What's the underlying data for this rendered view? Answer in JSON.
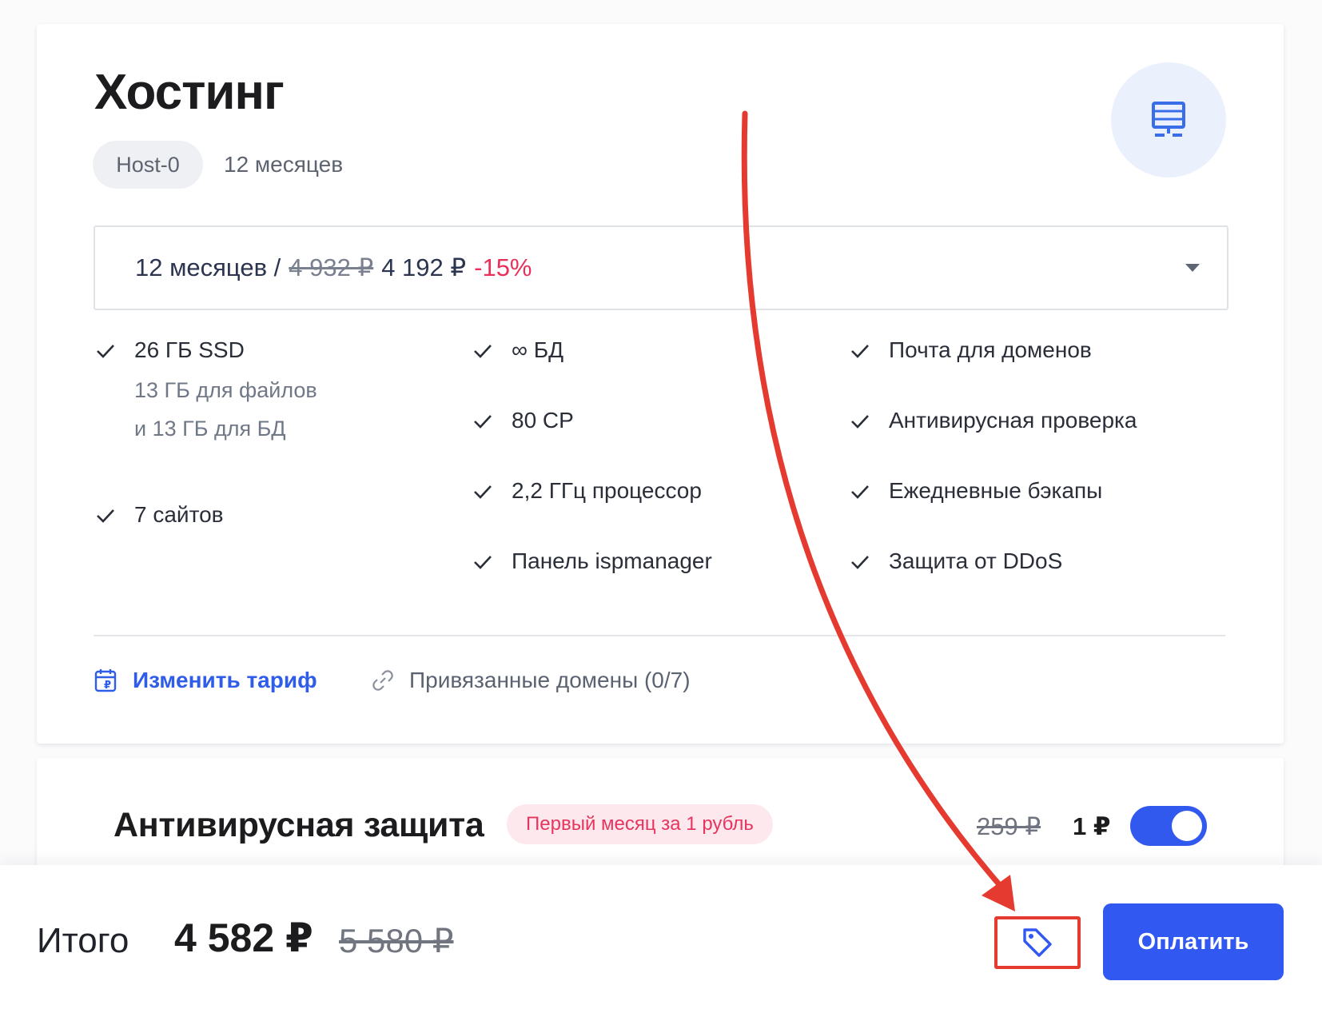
{
  "hosting": {
    "title": "Хостинг",
    "plan_name": "Host-0",
    "plan_period": "12 месяцев",
    "server_icon": "server-icon",
    "select": {
      "period": "12 месяцев /",
      "old_price": "4 932 ₽",
      "new_price": "4 192 ₽",
      "discount": "-15%"
    },
    "features": {
      "col1": [
        {
          "label": "26 ГБ SSD",
          "sub1": "13 ГБ для файлов",
          "sub2": "и 13 ГБ для БД"
        },
        {
          "label": "7 сайтов"
        }
      ],
      "col2": [
        {
          "label": "∞ БД"
        },
        {
          "label": "80 CP"
        },
        {
          "label": "2,2 ГГц процессор"
        },
        {
          "label": "Панель ispmanager"
        }
      ],
      "col3": [
        {
          "label": "Почта для доменов"
        },
        {
          "label": "Антивирусная проверка"
        },
        {
          "label": "Ежедневные бэкапы"
        },
        {
          "label": "Защита от DDoS"
        }
      ]
    },
    "actions": {
      "change_tariff": "Изменить тариф",
      "linked_domains": "Привязанные домены (0/7)"
    }
  },
  "antivirus": {
    "title": "Антивирусная защита",
    "badge": "Первый месяц за 1 рубль",
    "old_price": "259 ₽",
    "new_price": "1 ₽",
    "enabled": true
  },
  "footer": {
    "total_label": "Итого",
    "total_value": "4 582 ₽",
    "total_old": "5 580 ₽",
    "promo_icon": "tag-icon",
    "pay_label": "Оплатить"
  },
  "colors": {
    "accent": "#3158f0",
    "discount": "#e8315a",
    "annotation": "#e53a2f"
  }
}
